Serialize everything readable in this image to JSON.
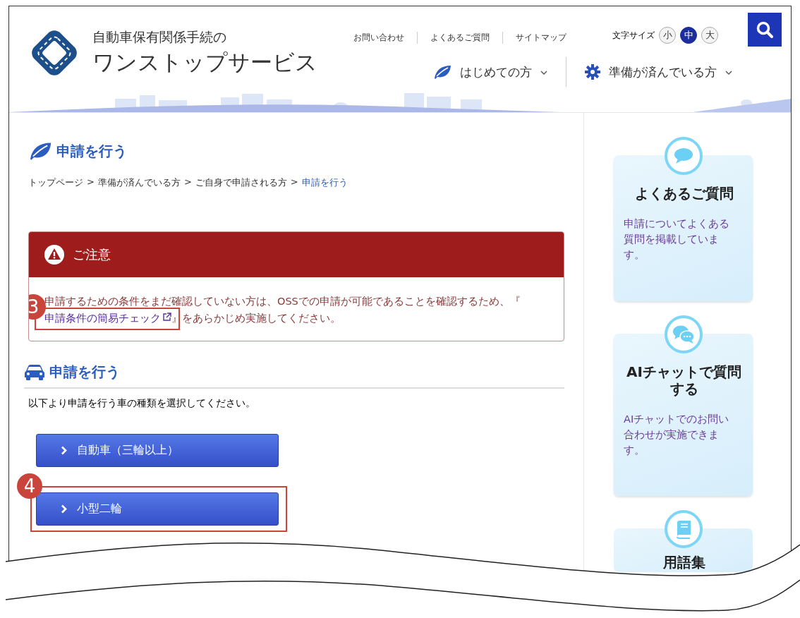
{
  "header": {
    "logo_line1": "自動車保有関係手続の",
    "logo_line2": "ワンストップサービス",
    "utility_links": [
      "お問い合わせ",
      "よくあるご質問",
      "サイトマップ"
    ],
    "font_size": {
      "label": "文字サイズ",
      "options": [
        {
          "label": "小",
          "selected": false
        },
        {
          "label": "中",
          "selected": true
        },
        {
          "label": "大",
          "selected": false
        }
      ]
    },
    "nav": [
      {
        "label": "はじめての方"
      },
      {
        "label": "準備が済んでいる方"
      }
    ]
  },
  "page_title": "申請を行う",
  "breadcrumb": [
    {
      "label": "トップページ",
      "current": false
    },
    {
      "label": "準備が済んでいる方",
      "current": false
    },
    {
      "label": "ご自身で申請される方",
      "current": false
    },
    {
      "label": "申請を行う",
      "current": true
    }
  ],
  "breadcrumb_separator": ">",
  "notice": {
    "title": "ご注意",
    "text_before": "申請するための条件をまだ確認していない方は、OSSでの申請が可能であることを確認するため、『",
    "link": "申請条件の簡易チェック",
    "text_after": "』をあらかじめ実施してください。"
  },
  "section": {
    "title": "申請を行う",
    "intro": "以下より申請を行う車の種類を選択してください。",
    "buttons": [
      {
        "label": "自動車（三輪以上）"
      },
      {
        "label": "小型二輪"
      }
    ]
  },
  "sidebar": [
    {
      "title": "よくあるご質問",
      "text": "申請についてよくある質問を掲載しています。"
    },
    {
      "title": "AIチャットで質問する",
      "text": "AIチャットでのお問い合わせが実施できます。"
    },
    {
      "title": "用語集"
    }
  ],
  "annotations": [
    {
      "number": "3"
    },
    {
      "number": "4"
    }
  ]
}
